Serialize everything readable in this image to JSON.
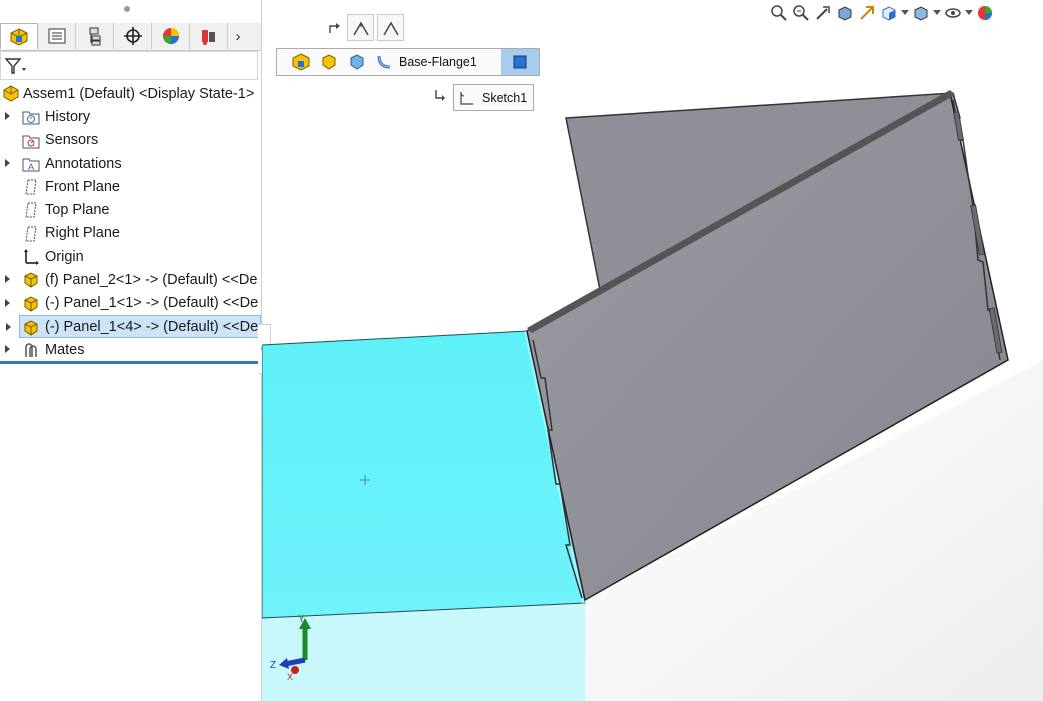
{
  "tabs": [
    {
      "icon": "feature-manager-icon",
      "active": true
    },
    {
      "icon": "property-manager-icon"
    },
    {
      "icon": "configuration-manager-icon"
    },
    {
      "icon": "dimxpert-icon"
    },
    {
      "icon": "display-manager-icon"
    },
    {
      "icon": "cam-icon"
    }
  ],
  "tree": {
    "root": "Assem1  (Default) <Display State-1>",
    "items": [
      {
        "label": "History",
        "icon": "history-folder-icon",
        "expandable": true
      },
      {
        "label": "Sensors",
        "icon": "sensors-folder-icon",
        "expandable": false
      },
      {
        "label": "Annotations",
        "icon": "annotations-folder-icon",
        "expandable": true
      },
      {
        "label": "Front Plane",
        "icon": "plane-icon",
        "expandable": false
      },
      {
        "label": "Top Plane",
        "icon": "plane-icon",
        "expandable": false
      },
      {
        "label": "Right Plane",
        "icon": "plane-icon",
        "expandable": false
      },
      {
        "label": "Origin",
        "icon": "origin-icon",
        "expandable": false
      },
      {
        "label": "(f) Panel_2<1> -> (Default) <<De",
        "icon": "part-icon",
        "expandable": true
      },
      {
        "label": "(-) Panel_1<1> -> (Default) <<De",
        "icon": "part-icon",
        "expandable": true
      },
      {
        "label": "(-) Panel_1<4> -> (Default) <<De",
        "icon": "part-icon",
        "expandable": true,
        "selected": true
      },
      {
        "label": "Mates",
        "icon": "mates-icon",
        "expandable": true
      }
    ]
  },
  "breadcrumb": {
    "feature_label": "Base-Flange1",
    "sketch_label": "Sketch1"
  },
  "colors": {
    "selection_face": "#5ef0f8",
    "panel_gray": "#8f8f98",
    "rollback_bar": "#2a7fc4",
    "breadcrumb_highlight": "#a7cdee"
  },
  "triad": {
    "y": "Y",
    "z": "Z",
    "x": "X"
  },
  "view_tools": [
    "zoom-to-fit-icon",
    "zoom-to-area-icon",
    "previous-view-icon",
    "section-view-icon",
    "dynamic-annotation-icon",
    "view-orientation-icon",
    "display-style-icon",
    "hide-show-icon",
    "appearance-icon"
  ]
}
